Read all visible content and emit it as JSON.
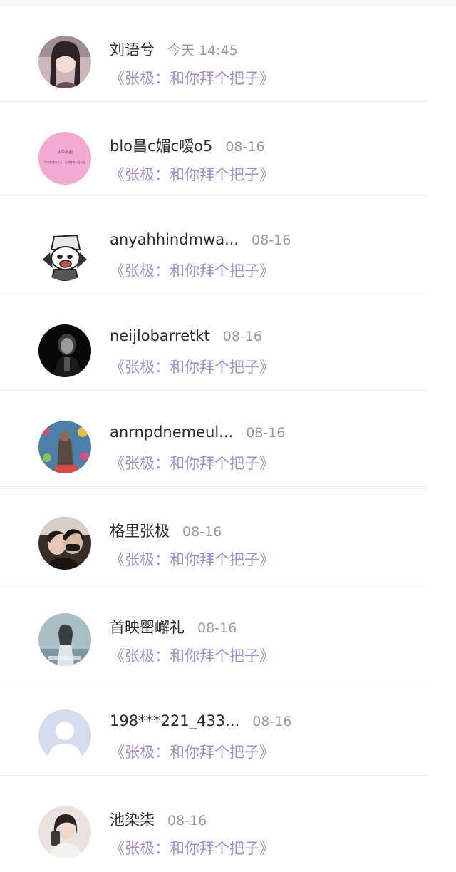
{
  "conversations": [
    {
      "name": "刘语兮",
      "time": "今天 14:45",
      "message": "《张极：和你拜个把子》",
      "avatar": "girl-photo-avatar"
    },
    {
      "name": "blo昌c媚c嗳o5",
      "time": "08-16",
      "message": "《张极：和你拜个把子》",
      "avatar": "pink-text-avatar",
      "avatar_text": [
        "从今天起",
        "学会尊重每个人，以同样的人性对待"
      ]
    },
    {
      "name": "anyahhindmwa...",
      "time": "08-16",
      "message": "《张极：和你拜个把子》",
      "avatar": "cartoon-cat-avatar"
    },
    {
      "name": "neijlobarretkt",
      "time": "08-16",
      "message": "《张极：和你拜个把子》",
      "avatar": "dark-joker-avatar"
    },
    {
      "name": "anrnpdnemeul...",
      "time": "08-16",
      "message": "《张极：和你拜个把子》",
      "avatar": "colorful-figure-avatar"
    },
    {
      "name": "格里张极",
      "time": "08-16",
      "message": "《张极：和你拜个把子》",
      "avatar": "couple-photo-avatar"
    },
    {
      "name": "首映罂嶰礼",
      "time": "08-16",
      "message": "《张极：和你拜个把子》",
      "avatar": "bluegrey-girl-avatar"
    },
    {
      "name": "198***221_433...",
      "time": "08-16",
      "message": "《张极：和你拜个把子》",
      "avatar": "default-user-avatar"
    },
    {
      "name": "池染柒",
      "time": "08-16",
      "message": "《张极：和你拜个把子》",
      "avatar": "selfie-girl-avatar"
    }
  ],
  "colors": {
    "message": "#a58cd6",
    "name": "#2b2b2b",
    "time": "#9a9a9a",
    "divider": "#efefef"
  }
}
